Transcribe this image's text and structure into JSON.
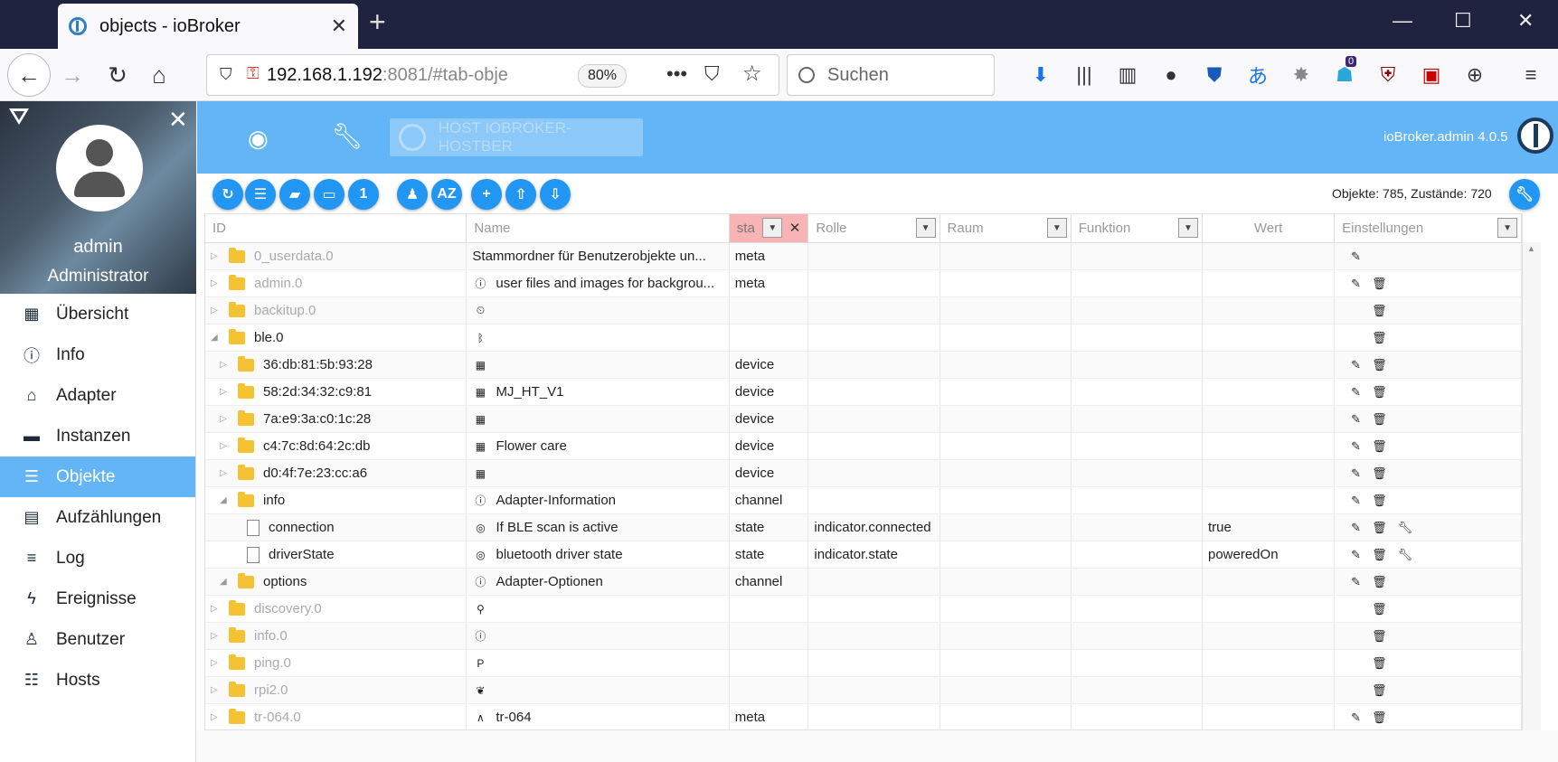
{
  "browser": {
    "tab_title": "objects - ioBroker",
    "url_host": "192.168.1.192",
    "url_rest": ":8081/#tab-obje",
    "zoom": "80%",
    "search_placeholder": "Suchen",
    "badge_count": "0"
  },
  "sidebar": {
    "user_name": "admin",
    "user_role": "Administrator",
    "items": [
      {
        "label": "Übersicht",
        "icon": "grid-icon"
      },
      {
        "label": "Info",
        "icon": "info-icon"
      },
      {
        "label": "Adapter",
        "icon": "store-icon"
      },
      {
        "label": "Instanzen",
        "icon": "instances-icon"
      },
      {
        "label": "Objekte",
        "icon": "list-icon",
        "active": true
      },
      {
        "label": "Aufzählungen",
        "icon": "enum-icon"
      },
      {
        "label": "Log",
        "icon": "log-icon"
      },
      {
        "label": "Ereignisse",
        "icon": "bolt-icon"
      },
      {
        "label": "Benutzer",
        "icon": "user-icon"
      },
      {
        "label": "Hosts",
        "icon": "hosts-icon"
      }
    ]
  },
  "header": {
    "host_label": "HOST IOBROKER-HOSTBER",
    "version": "ioBroker.admin 4.0.5"
  },
  "toolbar": {
    "count_text": "Objekte: 785, Zustände: 720"
  },
  "table": {
    "columns": {
      "id": "ID",
      "name": "Name",
      "type_filter": "sta",
      "role": "Rolle",
      "room": "Raum",
      "function": "Funktion",
      "value": "Wert",
      "settings": "Einstellungen"
    },
    "rows": [
      {
        "id": "0_userdata.0",
        "name": "Stammordner für Benutzerobjekte un...",
        "type": "meta",
        "role": "",
        "value": "",
        "dim": true,
        "level": 0,
        "kind": "folder"
      },
      {
        "id": "admin.0",
        "name": "user files and images for backgrou...",
        "type": "meta",
        "role": "",
        "value": "",
        "dim": true,
        "level": 0,
        "kind": "folder"
      },
      {
        "id": "backitup.0",
        "name": "",
        "type": "",
        "role": "",
        "value": "",
        "dim": true,
        "level": 0,
        "kind": "folder"
      },
      {
        "id": "ble.0",
        "name": "",
        "type": "",
        "role": "",
        "value": "",
        "dim": false,
        "level": 0,
        "kind": "folder"
      },
      {
        "id": "36:db:81:5b:93:28",
        "name": "",
        "type": "device",
        "role": "",
        "value": "",
        "dim": false,
        "level": 1,
        "kind": "folder"
      },
      {
        "id": "58:2d:34:32:c9:81",
        "name": "MJ_HT_V1",
        "type": "device",
        "role": "",
        "value": "",
        "dim": false,
        "level": 1,
        "kind": "folder"
      },
      {
        "id": "7a:e9:3a:c0:1c:28",
        "name": "",
        "type": "device",
        "role": "",
        "value": "",
        "dim": false,
        "level": 1,
        "kind": "folder"
      },
      {
        "id": "c4:7c:8d:64:2c:db",
        "name": "Flower care",
        "type": "device",
        "role": "",
        "value": "",
        "dim": false,
        "level": 1,
        "kind": "folder"
      },
      {
        "id": "d0:4f:7e:23:cc:a6",
        "name": "",
        "type": "device",
        "role": "",
        "value": "",
        "dim": false,
        "level": 1,
        "kind": "folder"
      },
      {
        "id": "info",
        "name": "Adapter-Information",
        "type": "channel",
        "role": "",
        "value": "",
        "dim": false,
        "level": 1,
        "kind": "folder"
      },
      {
        "id": "connection",
        "name": "If BLE scan is active",
        "type": "state",
        "role": "indicator.connected",
        "value": "true",
        "dim": false,
        "level": 2,
        "kind": "file"
      },
      {
        "id": "driverState",
        "name": "bluetooth driver state",
        "type": "state",
        "role": "indicator.state",
        "value": "poweredOn",
        "dim": false,
        "level": 2,
        "kind": "file"
      },
      {
        "id": "options",
        "name": "Adapter-Optionen",
        "type": "channel",
        "role": "",
        "value": "",
        "dim": false,
        "level": 1,
        "kind": "folder"
      },
      {
        "id": "discovery.0",
        "name": "",
        "type": "",
        "role": "",
        "value": "",
        "dim": true,
        "level": 0,
        "kind": "folder"
      },
      {
        "id": "info.0",
        "name": "",
        "type": "",
        "role": "",
        "value": "",
        "dim": true,
        "level": 0,
        "kind": "folder"
      },
      {
        "id": "ping.0",
        "name": "",
        "type": "",
        "role": "",
        "value": "",
        "dim": true,
        "level": 0,
        "kind": "folder"
      },
      {
        "id": "rpi2.0",
        "name": "",
        "type": "",
        "role": "",
        "value": "",
        "dim": true,
        "level": 0,
        "kind": "folder"
      },
      {
        "id": "tr-064.0",
        "name": "tr-064",
        "type": "meta",
        "role": "",
        "value": "",
        "dim": true,
        "level": 0,
        "kind": "folder"
      }
    ]
  },
  "colors": {
    "accent": "#64b5f6",
    "button": "#2196f3",
    "filter": "#f8b4b4"
  }
}
